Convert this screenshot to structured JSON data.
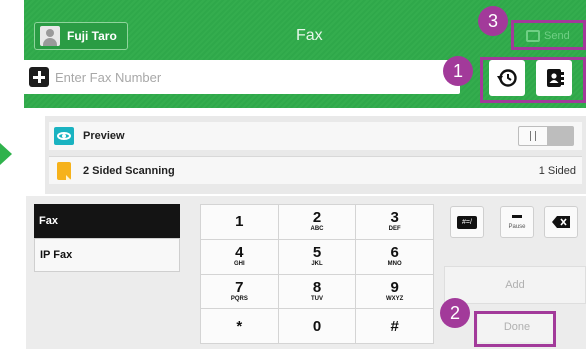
{
  "header": {
    "user_name": "Fuji Taro",
    "title": "Fax",
    "send_label": "Send"
  },
  "fax_number": {
    "placeholder": "Enter Fax Number",
    "value": ""
  },
  "settings": {
    "preview_label": "Preview",
    "duplex_label": "2 Sided Scanning",
    "duplex_value": "1 Sided"
  },
  "fax_types": [
    "Fax",
    "IP Fax"
  ],
  "keypad": [
    {
      "num": "1",
      "letters": ""
    },
    {
      "num": "2",
      "letters": "ABC"
    },
    {
      "num": "3",
      "letters": "DEF"
    },
    {
      "num": "4",
      "letters": "GHI"
    },
    {
      "num": "5",
      "letters": "JKL"
    },
    {
      "num": "6",
      "letters": "MNO"
    },
    {
      "num": "7",
      "letters": "PQRS"
    },
    {
      "num": "8",
      "letters": "TUV"
    },
    {
      "num": "9",
      "letters": "WXYZ"
    },
    {
      "num": "*",
      "letters": ""
    },
    {
      "num": "0",
      "letters": ""
    },
    {
      "num": "#",
      "letters": ""
    }
  ],
  "function_keys": {
    "dial_symbol": "#=/",
    "pause_label": "Pause"
  },
  "actions": {
    "add_label": "Add",
    "done_label": "Done"
  },
  "annotations": {
    "badge_1": "1",
    "badge_2": "2",
    "badge_3": "3"
  },
  "colors": {
    "header_green": "#2fa84a",
    "annotation_purple": "#a23a9a",
    "preview_icon": "#1ab3c1",
    "duplex_icon": "#f6b21b"
  }
}
